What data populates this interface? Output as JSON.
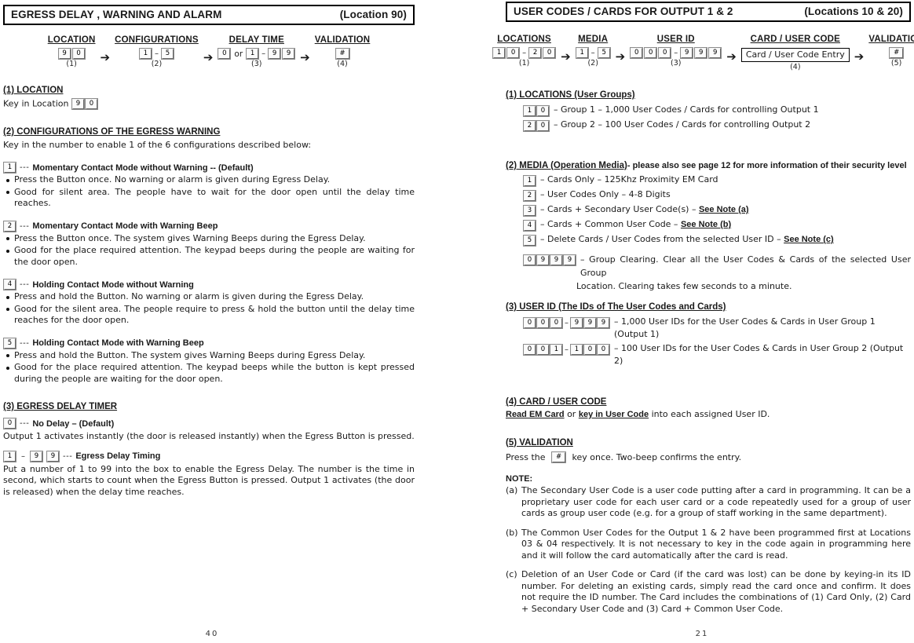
{
  "left_page": {
    "banner": {
      "title": "EGRESS DELAY , WARNING AND ALARM",
      "location": "(Location 90)"
    },
    "flow": {
      "steps": [
        {
          "heading": "LOCATION",
          "keys": [
            "9",
            "0"
          ],
          "index": "(1)"
        },
        {
          "heading": "CONFIGURATIONS",
          "keys": [
            "1",
            "5"
          ],
          "index": "(2)"
        },
        {
          "heading": "DELAY TIME",
          "keys": [
            "0",
            "1",
            "9",
            "9"
          ],
          "index": "(3)",
          "or_label": "or"
        },
        {
          "heading": "VALIDATION",
          "keys": [
            "#"
          ],
          "index": "(4)"
        }
      ],
      "arrow": "➔",
      "dash": "–"
    },
    "s1": {
      "heading": "(1) LOCATION",
      "text_before": "Key in Location",
      "keys": [
        "9",
        "0"
      ]
    },
    "s2": {
      "heading": "(2) CONFIGURATIONS OF THE EGRESS WARNING",
      "intro": "Key in the number to enable 1 of the 6 configurations described below:",
      "options": [
        {
          "key": "1",
          "dashes": "---",
          "name": "Momentary Contact Mode without Warning -- (Default)",
          "bullets": [
            "Press the Button once. No warning or alarm is given during Egress Delay.",
            "Good for silent area. The people have to wait for the door open until the delay time reaches."
          ]
        },
        {
          "key": "2",
          "dashes": "---",
          "name": "Momentary Contact Mode with Warning Beep",
          "bullets": [
            "Press the Button once. The system gives Warning Beeps during the Egress Delay.",
            "Good for the place required attention. The keypad beeps during the people are waiting for the door open."
          ]
        },
        {
          "key": "4",
          "dashes": "---",
          "name": "Holding Contact Mode without Warning",
          "bullets": [
            "Press and hold the Button. No warning or alarm is given during the Egress Delay.",
            "Good for the silent area. The people require to press & hold the button until the delay time reaches for the door open."
          ]
        },
        {
          "key": "5",
          "dashes": "---",
          "name": "Holding Contact Mode with Warning Beep",
          "bullets": [
            "Press and hold the Button. The system gives Warning Beeps during Egress Delay.",
            "Good for the place required attention. The keypad beeps while the button is kept pressed during the people are waiting for the door open."
          ]
        }
      ]
    },
    "s3": {
      "heading": "(3) EGRESS DELAY TIMER",
      "no_delay": {
        "key": "0",
        "dashes": "---",
        "name": "No Delay – (Default)",
        "text": "Output 1 activates instantly (the door is released instantly) when the Egress Button is pressed."
      },
      "timing": {
        "keys": [
          "1",
          "9",
          "9"
        ],
        "dash": "–",
        "dashes": "---",
        "name": "Egress Delay Timing",
        "text": "Put a number of 1 to 99 into the box to enable the Egress Delay. The number is the time in second, which starts to count when the Egress Button is pressed. Output 1 activates (the door is released) when the delay time reaches."
      }
    },
    "page_number": "40"
  },
  "right_page": {
    "banner": {
      "title": "USER CODES / CARDS FOR OUTPUT 1 & 2",
      "location": "(Locations 10 & 20)"
    },
    "flow": {
      "steps": [
        {
          "heading": "LOCATIONS",
          "keys": [
            "1",
            "0",
            "2",
            "0"
          ],
          "index": "(1)"
        },
        {
          "heading": "MEDIA",
          "keys": [
            "1",
            "5"
          ],
          "index": "(2)"
        },
        {
          "heading": "USER ID",
          "keys": [
            "0",
            "0",
            "0",
            "9",
            "9",
            "9"
          ],
          "index": "(3)"
        },
        {
          "heading": "CARD / USER CODE",
          "entry": "Card / User Code Entry",
          "index": "(4)"
        },
        {
          "heading": "VALIDATION",
          "keys": [
            "#"
          ],
          "index": "(5)"
        }
      ],
      "arrow": "➔",
      "dash": "–"
    },
    "s1": {
      "heading": "(1) LOCATIONS (User Groups)",
      "rows": [
        {
          "keys": [
            "1",
            "0"
          ],
          "text": "– Group 1 – 1,000 User Codes / Cards for controlling Output 1"
        },
        {
          "keys": [
            "2",
            "0"
          ],
          "text": "– Group 2 – 100 User Codes / Cards for controlling Output 2"
        }
      ]
    },
    "s2": {
      "heading_underlined": "(2) MEDIA (Operation Media)",
      "heading_rest": "- please also see page 12 for more information of their security level",
      "rows": [
        {
          "keys": [
            "1"
          ],
          "text": "– Cards Only – 125Khz Proximity EM Card",
          "note": ""
        },
        {
          "keys": [
            "2"
          ],
          "text": "– User Codes Only – 4-8 Digits",
          "note": ""
        },
        {
          "keys": [
            "3"
          ],
          "text": "– Cards + Secondary User Code(s) – ",
          "note": "See Note (a)"
        },
        {
          "keys": [
            "4"
          ],
          "text": "– Cards + Common User Code – ",
          "note": "See Note (b)"
        },
        {
          "keys": [
            "5"
          ],
          "text": "– Delete Cards / User Codes from the selected User ID – ",
          "note": "See Note (c)"
        }
      ],
      "group_clearing": {
        "keys": [
          "0",
          "9",
          "9",
          "9"
        ],
        "line1": "–  Group Clearing. Clear all the User Codes & Cards of the selected User Group",
        "line2": "Location. Clearing takes few seconds to a minute."
      }
    },
    "s3": {
      "heading": "(3) USER ID (The IDs of The User Codes and Cards)",
      "rows": [
        {
          "keys_a": [
            "0",
            "0",
            "0"
          ],
          "keys_b": [
            "9",
            "9",
            "9"
          ],
          "dash": "–",
          "text": "– 1,000 User IDs for the User Codes & Cards in User Group 1 (Output 1)"
        },
        {
          "keys_a": [
            "0",
            "0",
            "1"
          ],
          "keys_b": [
            "1",
            "0",
            "0"
          ],
          "dash": "–",
          "text": "– 100 User IDs for the User Codes & Cards in User Group 2 (Output 2)"
        }
      ]
    },
    "s4": {
      "heading": "(4) CARD / USER CODE",
      "bold_a": "Read EM Card",
      "mid": " or ",
      "bold_b": "key in User Code",
      "tail": " into each assigned User ID."
    },
    "s5": {
      "heading": "(5) VALIDATION",
      "text_before": "Press the",
      "key": "#",
      "text_after": "key once. Two-beep confirms the entry."
    },
    "notes": {
      "title": "NOTE:",
      "items": [
        {
          "label": "(a)",
          "text": "The Secondary User Code is a user code putting after a card in programming. It can be a proprietary user code for each user card or a code repeatedly used for a group of user cards as group user code (e.g. for a group of staff working in the same department)."
        },
        {
          "label": "(b)",
          "text": "The Common User Codes for the Output 1 & 2 have been programmed first at Locations 03 & 04 respectively. It is not necessary to key in the code again in programming here and it will follow the card automatically after the card is read."
        },
        {
          "label": "(c)",
          "text": "Deletion of an User Code or Card (if the card was lost) can be done by keying-in its ID number. For deleting an existing cards, simply read the card once and confirm. It does not require the ID number. The Card includes the combinations of (1) Card Only, (2) Card + Secondary User Code and (3) Card + Common User Code."
        }
      ]
    },
    "page_number": "21"
  }
}
